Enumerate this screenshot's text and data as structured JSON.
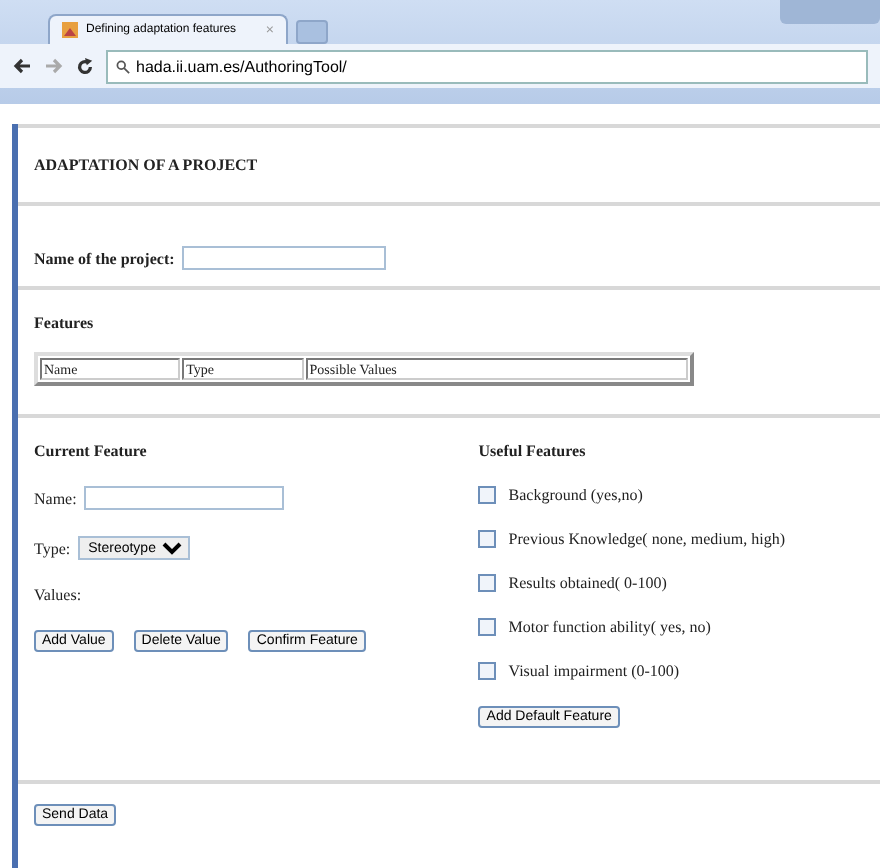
{
  "browser": {
    "tab_title": "Defining adaptation features",
    "tab_close": "×",
    "address": "hada.ii.uam.es/AuthoringTool/"
  },
  "page": {
    "title": "ADAPTATION OF A PROJECT",
    "project": {
      "label": "Name of the project:"
    },
    "features": {
      "heading": "Features",
      "columns": [
        "Name",
        "Type",
        "Possible Values"
      ]
    },
    "current_feature": {
      "heading": "Current Feature",
      "name_label": "Name:",
      "type_label": "Type:",
      "type_value": "Stereotype",
      "values_label": "Values:",
      "buttons": [
        "Add Value",
        "Delete Value",
        "Confirm Feature"
      ]
    },
    "useful_features": {
      "heading": "Useful Features",
      "items": [
        {
          "label": "Background (yes,no)",
          "checked": false
        },
        {
          "label": "Previous Knowledge( none, medium, high)",
          "checked": false
        },
        {
          "label": "Results obtained( 0-100)",
          "checked": false
        },
        {
          "label": "Motor function ability( yes, no)",
          "checked": false
        },
        {
          "label": "Visual impairment (0-100)",
          "checked": false
        }
      ],
      "button": "Add Default Feature"
    },
    "send_button": "Send Data"
  }
}
